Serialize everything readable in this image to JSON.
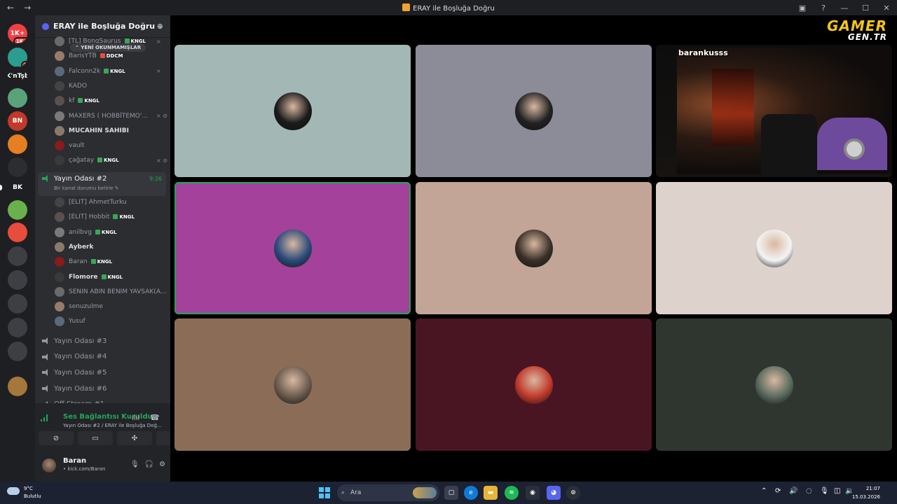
{
  "window": {
    "title": "ERAY ile Boşluğa Doğru",
    "back": "←",
    "forward": "→"
  },
  "server": {
    "name": "ERAY ile Boşluğa Doğru",
    "unread_pill": "⌃ YENİ OKUNMAMIŞLAR"
  },
  "guilds": [
    {
      "label": "1K+",
      "badge": "1K+",
      "color": "#f23f43"
    },
    {
      "label": "",
      "badge": "1",
      "color": "#2a9d8f"
    },
    {
      "label": "K'nTşb",
      "badge": "",
      "color": "#1e1f22"
    },
    {
      "label": "",
      "badge": "",
      "color": "#5aa37a"
    },
    {
      "label": "BN",
      "badge": "",
      "color": "#c0392b"
    },
    {
      "label": "",
      "badge": "",
      "color": "#e67e22"
    },
    {
      "label": "",
      "badge": "",
      "color": "#2b2d31"
    },
    {
      "label": "BK",
      "badge": "",
      "color": "#1e1f22"
    },
    {
      "label": "",
      "badge": "",
      "color": "#6ab04c"
    },
    {
      "label": "",
      "badge": "",
      "color": "#e74c3c"
    },
    {
      "label": "",
      "badge": "",
      "color": "#3d3f45"
    },
    {
      "label": "",
      "badge": "",
      "color": "#3d3f45"
    },
    {
      "label": "",
      "badge": "",
      "color": "#3d3f45"
    },
    {
      "label": "",
      "badge": "",
      "color": "#3d3f45"
    },
    {
      "label": "",
      "badge": "",
      "color": "#3d3f45"
    },
    {
      "label": "",
      "badge": "",
      "color": "#a4773a"
    }
  ],
  "channel_list": {
    "top_users": [
      {
        "name": "[TL] BongSaurus",
        "tag": "KNGL",
        "icons": "⨯"
      },
      {
        "name": "BarisYTB",
        "tag": "DDCM",
        "icons": ""
      },
      {
        "name": "Falconn2k",
        "tag": "KNGL",
        "icons": "⨯"
      },
      {
        "name": "KADO",
        "tag": "",
        "icons": ""
      },
      {
        "name": "kf",
        "tag": "KNGL",
        "icons": ""
      },
      {
        "name": "MAXERS ( HOBBİTEMO'...",
        "tag": "",
        "icons": "⨯ ⊘"
      },
      {
        "name": "MUCAHIN SAHIBI",
        "tag": "",
        "icons": ""
      },
      {
        "name": "vault",
        "tag": "",
        "icons": ""
      },
      {
        "name": "çağatay",
        "tag": "KNGL",
        "icons": "⨯ ⊘"
      }
    ],
    "active_channel": {
      "name": "Yayın Odası #2",
      "timer": "9:26",
      "status": "Bir kanal durumu belirle ✎"
    },
    "active_users": [
      {
        "name": "[ELIT] AhmetTurku",
        "tag": ""
      },
      {
        "name": "[ELIT] Hobbit",
        "tag": "KNGL"
      },
      {
        "name": "anilbvg",
        "tag": "KNGL"
      },
      {
        "name": "Ayberk",
        "tag": ""
      },
      {
        "name": "Baran",
        "tag": "KNGL"
      },
      {
        "name": "Flomore",
        "tag": "KNGL"
      },
      {
        "name": "SENIN ABIN BENIM YAVSAK(A...",
        "tag": ""
      },
      {
        "name": "senuzulme",
        "tag": ""
      },
      {
        "name": "Yusuf",
        "tag": ""
      }
    ],
    "other_channels": [
      "Yayın Odası #3",
      "Yayın Odası #4",
      "Yayın Odası #5",
      "Yayın Odası #6",
      "Off Stream #1"
    ]
  },
  "voice_panel": {
    "status": "Ses Bağlantısı Kuruldu",
    "location": "Yayın Odası #2 / ERAY ile Boşluğa Doğ...",
    "user_name": "Baran",
    "user_status": "• kick.com/Baran"
  },
  "stage": {
    "stream_name": "barankusss",
    "watermark_top": "GAMER",
    "watermark_bottom": "GEN.TR",
    "tiles": [
      {
        "bg": "#a3b8b4",
        "avatar": "#1a1a1a"
      },
      {
        "bg": "#8b8c98",
        "avatar": "#222"
      },
      {
        "bg": "stream",
        "avatar": ""
      },
      {
        "bg": "#a4419a",
        "avatar": "#2b4a7a",
        "speaking": true
      },
      {
        "bg": "#c2a596",
        "avatar": "#3a3028"
      },
      {
        "bg": "#ddd3cc",
        "avatar": "#f4f4f4"
      },
      {
        "bg": "#8b6d57",
        "avatar": "#6a5a4e"
      },
      {
        "bg": "#4a1522",
        "avatar": "#c0392b"
      },
      {
        "bg": "#2f3630",
        "avatar": "#5a6a5e"
      }
    ]
  },
  "taskbar": {
    "temperature": "9°C",
    "condition": "Bulutlu",
    "search_placeholder": "Ara",
    "time": "21:07",
    "date": "15.03.2026"
  }
}
